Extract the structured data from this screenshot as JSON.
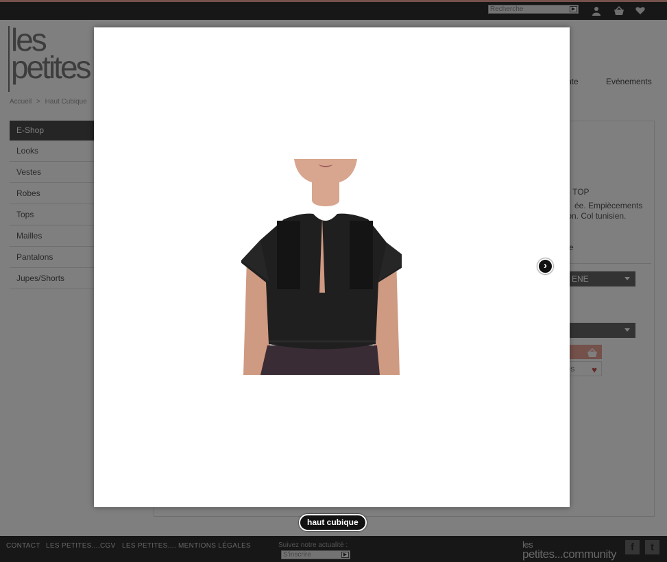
{
  "header": {
    "search_placeholder": "Recherche",
    "search_go": "▶",
    "icons": [
      "user-icon",
      "basket-icon",
      "heart-icon"
    ]
  },
  "logo": {
    "line1": "les",
    "line2": "petites"
  },
  "nav": {
    "item_partial": "nte",
    "events": "Evénements"
  },
  "breadcrumb": {
    "home": "Accueil",
    "sep": ">",
    "current": "Haut Cubique"
  },
  "sidebar": {
    "active": "E-Shop",
    "items": [
      {
        "label": "Looks"
      },
      {
        "label": "Vestes"
      },
      {
        "label": "Robes"
      },
      {
        "label": "Tops"
      },
      {
        "label": "Mailles"
      },
      {
        "label": "Pantalons"
      },
      {
        "label": "Jupes/Shorts"
      }
    ]
  },
  "product": {
    "title_partial": "- TOP",
    "desc_line1": "ée.  Empiècements",
    "desc_line2": "ton.  Col  tunisien.",
    "link_partial": "e",
    "color_select": "ENE",
    "cart_icon": "basket-icon",
    "wish_partial": "ies",
    "wish_icon": "heart-icon"
  },
  "lightbox": {
    "caption": "haut cubique",
    "next_icon": "›"
  },
  "footer": {
    "contact": "CONTACT",
    "cgv": "LES PETITES....CGV",
    "legal": "LES PETITES.... MENTIONS LÉGALES",
    "newsletter_label": "Suivez notre actualité :",
    "subscribe_placeholder": "S'inscrire",
    "subscribe_go": "▶",
    "community_top": "les",
    "community_bottom": "petites...community",
    "facebook": "f",
    "twitter": "t"
  },
  "colors": {
    "accent": "#e8a294",
    "dark_bar": "#2e2e2e",
    "overlay": "rgba(0,0,0,0.5)"
  }
}
